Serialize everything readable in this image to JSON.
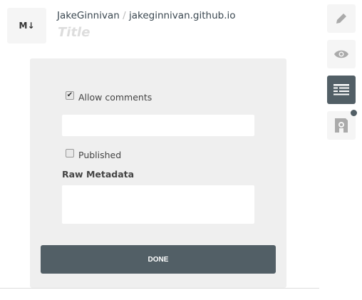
{
  "header": {
    "logo": "M↓",
    "owner": "JakeGinnivan",
    "separator": "/",
    "repo": "jakeginnivan.github.io",
    "title_placeholder": "Title"
  },
  "form": {
    "allow_comments": {
      "label": "Allow comments",
      "checked": true
    },
    "comments_field": {
      "value": ""
    },
    "published": {
      "label": "Published",
      "checked": false
    },
    "raw_metadata": {
      "label": "Raw Metadata",
      "value": ""
    },
    "done_label": "DONE"
  },
  "toolbar": [
    "pencil-icon",
    "eye-icon",
    "metadata-icon",
    "save-icon"
  ],
  "colors": {
    "accent": "#525f66",
    "panel": "#efefef"
  }
}
